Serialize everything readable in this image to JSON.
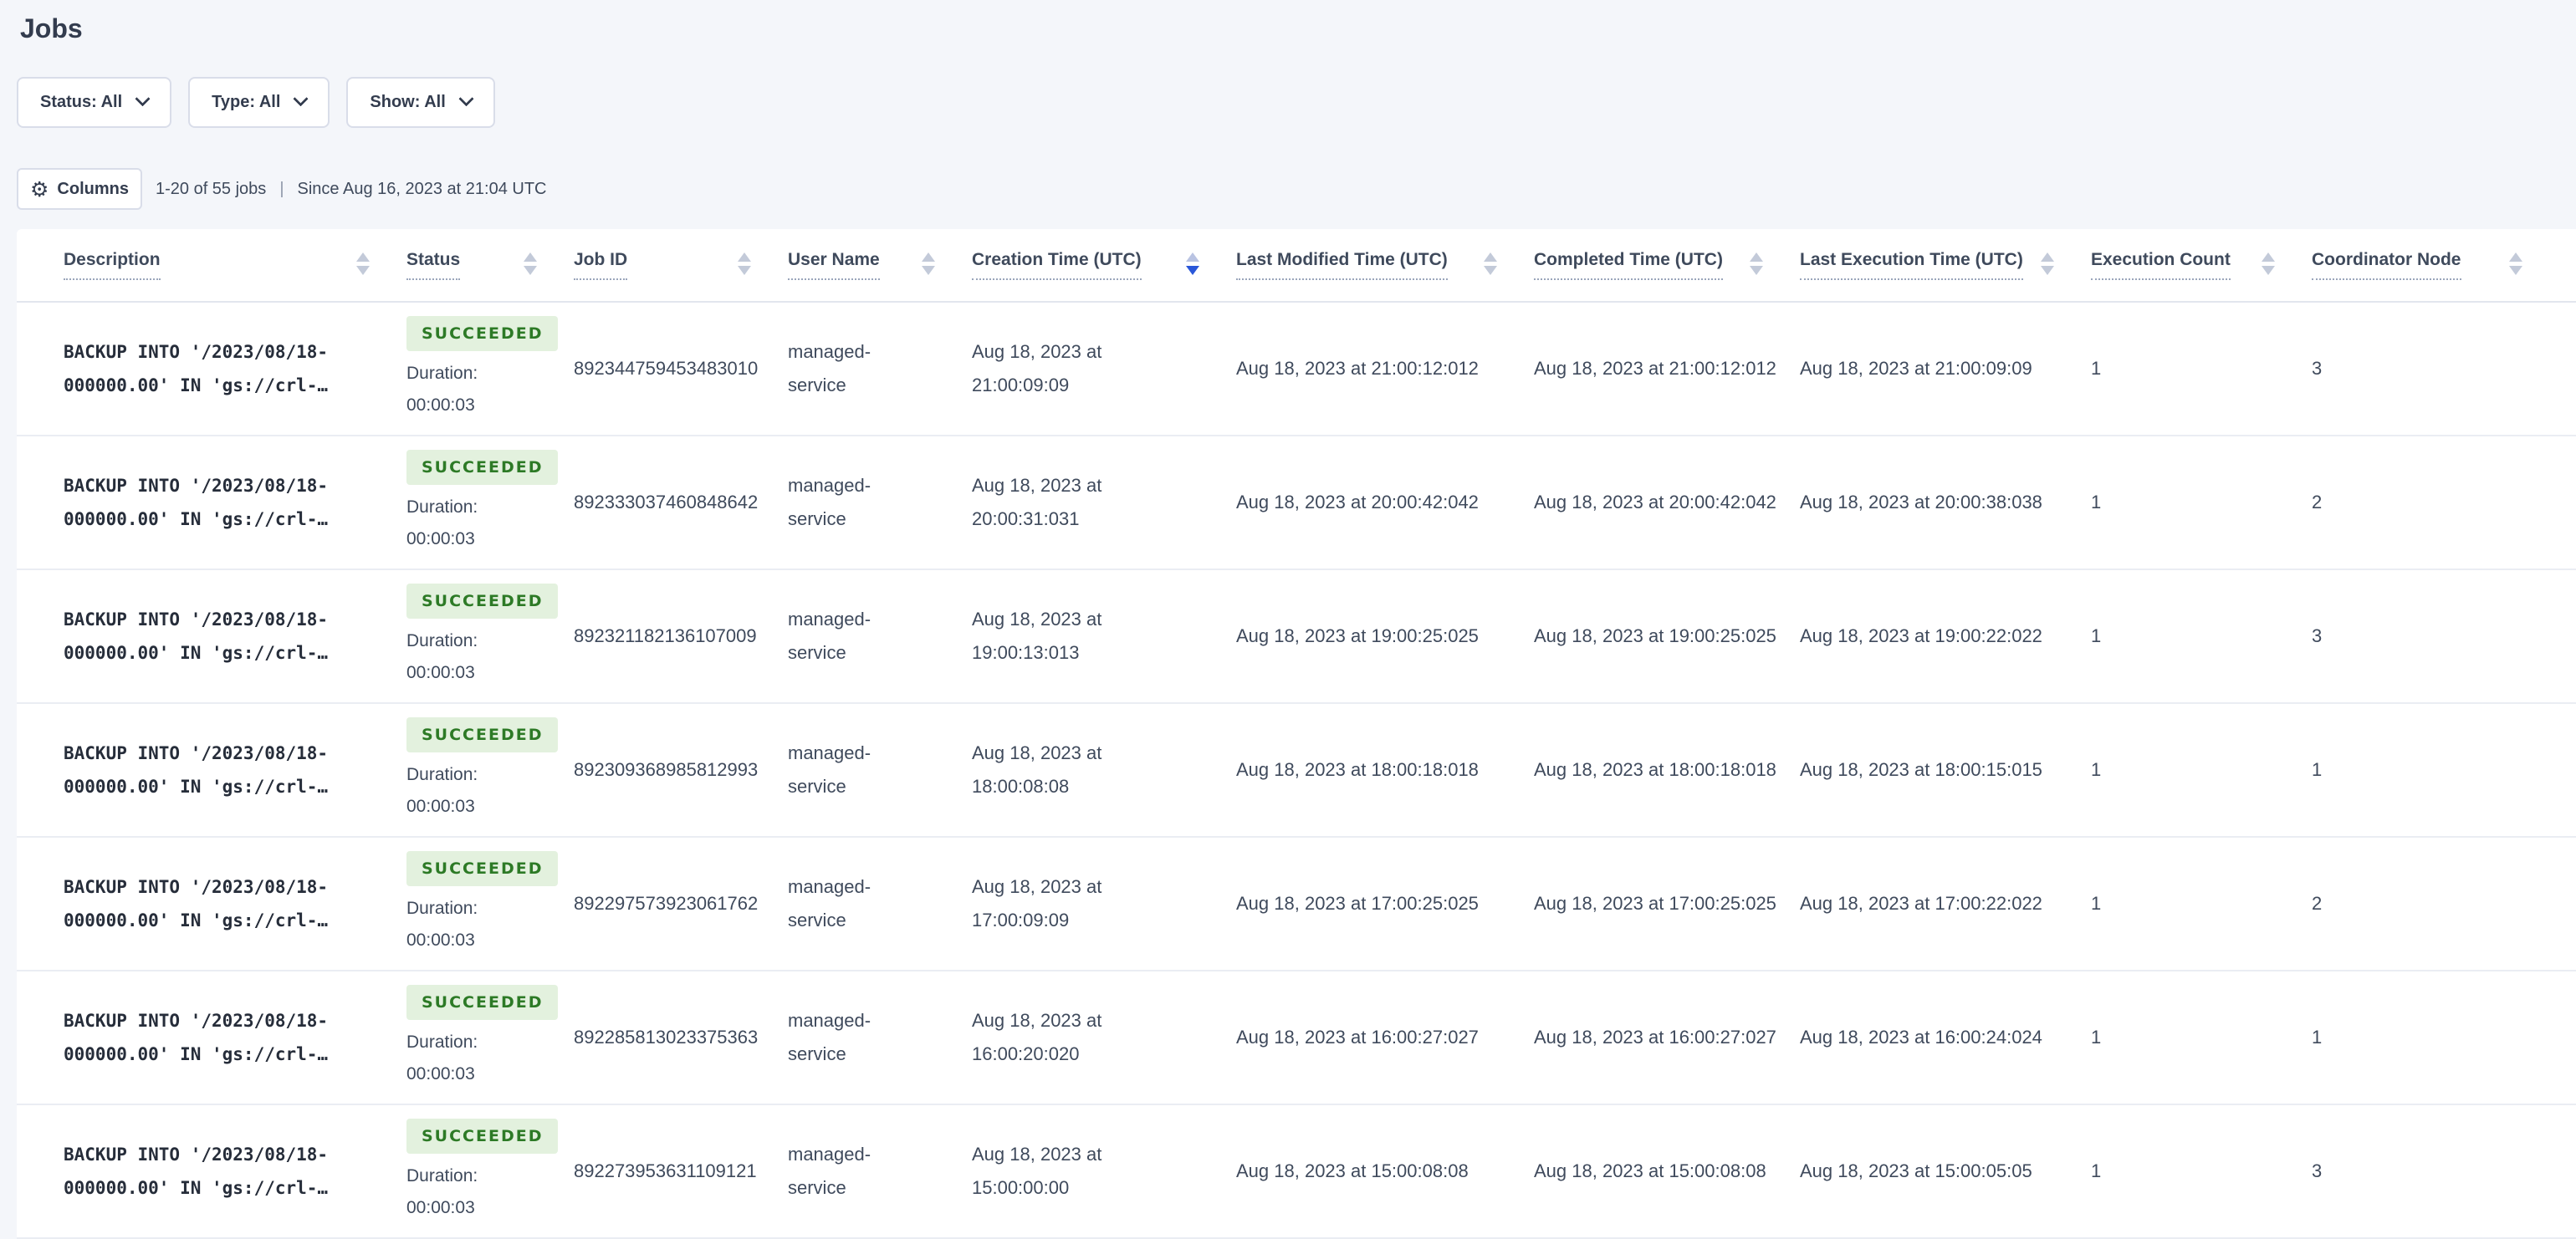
{
  "page": {
    "title": "Jobs"
  },
  "filters": [
    {
      "label": "Status: All"
    },
    {
      "label": "Type: All"
    },
    {
      "label": "Show: All"
    }
  ],
  "toolbar": {
    "columns_label": "Columns",
    "gear_icon": "⚙",
    "count_text": "1-20 of 55 jobs",
    "separator": "|",
    "since_text": "Since Aug 16, 2023 at 21:04 UTC"
  },
  "colors": {
    "badge_bg": "#e3f1de",
    "badge_text": "#2d7a26",
    "sort_active": "#2a57d9",
    "page_bg": "#f4f6fa"
  },
  "table": {
    "columns": [
      {
        "label": "Description",
        "sort": "none"
      },
      {
        "label": "Status",
        "sort": "none"
      },
      {
        "label": "Job ID",
        "sort": "none"
      },
      {
        "label": "User Name",
        "sort": "none"
      },
      {
        "label": "Creation Time (UTC)",
        "sort": "desc"
      },
      {
        "label": "Last Modified Time (UTC)",
        "sort": "none"
      },
      {
        "label": "Completed Time (UTC)",
        "sort": "none"
      },
      {
        "label": "Last Execution Time (UTC)",
        "sort": "none"
      },
      {
        "label": "Execution Count",
        "sort": "none"
      },
      {
        "label": "Coordinator Node",
        "sort": "none"
      }
    ],
    "rows": [
      {
        "description": "BACKUP INTO '/2023/08/18-\n000000.00' IN 'gs://crl-…",
        "status": "SUCCEEDED",
        "duration_label": "Duration:",
        "duration": "00:00:03",
        "job_id": "892344759453483010",
        "user_name": "managed-\nservice",
        "creation_time": "Aug 18, 2023 at\n21:00:09:09",
        "last_modified_time": "Aug 18, 2023 at 21:00:12:012",
        "completed_time": "Aug 18, 2023 at 21:00:12:012",
        "last_execution_time": "Aug 18, 2023 at 21:00:09:09",
        "execution_count": "1",
        "coordinator_node": "3"
      },
      {
        "description": "BACKUP INTO '/2023/08/18-\n000000.00' IN 'gs://crl-…",
        "status": "SUCCEEDED",
        "duration_label": "Duration:",
        "duration": "00:00:03",
        "job_id": "892333037460848642",
        "user_name": "managed-\nservice",
        "creation_time": "Aug 18, 2023 at\n20:00:31:031",
        "last_modified_time": "Aug 18, 2023 at 20:00:42:042",
        "completed_time": "Aug 18, 2023 at 20:00:42:042",
        "last_execution_time": "Aug 18, 2023 at 20:00:38:038",
        "execution_count": "1",
        "coordinator_node": "2"
      },
      {
        "description": "BACKUP INTO '/2023/08/18-\n000000.00' IN 'gs://crl-…",
        "status": "SUCCEEDED",
        "duration_label": "Duration:",
        "duration": "00:00:03",
        "job_id": "892321182136107009",
        "user_name": "managed-\nservice",
        "creation_time": "Aug 18, 2023 at\n19:00:13:013",
        "last_modified_time": "Aug 18, 2023 at 19:00:25:025",
        "completed_time": "Aug 18, 2023 at 19:00:25:025",
        "last_execution_time": "Aug 18, 2023 at 19:00:22:022",
        "execution_count": "1",
        "coordinator_node": "3"
      },
      {
        "description": "BACKUP INTO '/2023/08/18-\n000000.00' IN 'gs://crl-…",
        "status": "SUCCEEDED",
        "duration_label": "Duration:",
        "duration": "00:00:03",
        "job_id": "892309368985812993",
        "user_name": "managed-\nservice",
        "creation_time": "Aug 18, 2023 at\n18:00:08:08",
        "last_modified_time": "Aug 18, 2023 at 18:00:18:018",
        "completed_time": "Aug 18, 2023 at 18:00:18:018",
        "last_execution_time": "Aug 18, 2023 at 18:00:15:015",
        "execution_count": "1",
        "coordinator_node": "1"
      },
      {
        "description": "BACKUP INTO '/2023/08/18-\n000000.00' IN 'gs://crl-…",
        "status": "SUCCEEDED",
        "duration_label": "Duration:",
        "duration": "00:00:03",
        "job_id": "892297573923061762",
        "user_name": "managed-\nservice",
        "creation_time": "Aug 18, 2023 at\n17:00:09:09",
        "last_modified_time": "Aug 18, 2023 at 17:00:25:025",
        "completed_time": "Aug 18, 2023 at 17:00:25:025",
        "last_execution_time": "Aug 18, 2023 at 17:00:22:022",
        "execution_count": "1",
        "coordinator_node": "2"
      },
      {
        "description": "BACKUP INTO '/2023/08/18-\n000000.00' IN 'gs://crl-…",
        "status": "SUCCEEDED",
        "duration_label": "Duration:",
        "duration": "00:00:03",
        "job_id": "892285813023375363",
        "user_name": "managed-\nservice",
        "creation_time": "Aug 18, 2023 at\n16:00:20:020",
        "last_modified_time": "Aug 18, 2023 at 16:00:27:027",
        "completed_time": "Aug 18, 2023 at 16:00:27:027",
        "last_execution_time": "Aug 18, 2023 at 16:00:24:024",
        "execution_count": "1",
        "coordinator_node": "1"
      },
      {
        "description": "BACKUP INTO '/2023/08/18-\n000000.00' IN 'gs://crl-…",
        "status": "SUCCEEDED",
        "duration_label": "Duration:",
        "duration": "00:00:03",
        "job_id": "892273953631109121",
        "user_name": "managed-\nservice",
        "creation_time": "Aug 18, 2023 at\n15:00:00:00",
        "last_modified_time": "Aug 18, 2023 at 15:00:08:08",
        "completed_time": "Aug 18, 2023 at 15:00:08:08",
        "last_execution_time": "Aug 18, 2023 at 15:00:05:05",
        "execution_count": "1",
        "coordinator_node": "3"
      }
    ]
  }
}
